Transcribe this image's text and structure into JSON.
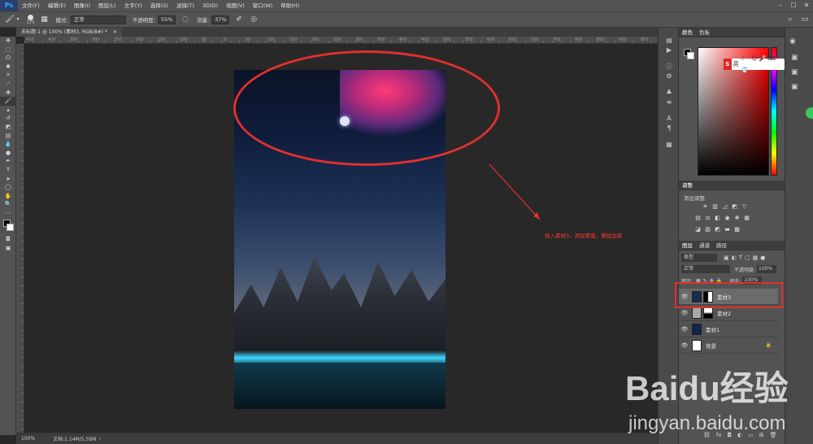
{
  "app": {
    "logo": "Ps"
  },
  "menu": [
    "文件(F)",
    "编辑(E)",
    "图像(I)",
    "图层(L)",
    "文字(Y)",
    "选择(S)",
    "滤镜(T)",
    "3D(D)",
    "视图(V)",
    "窗口(W)",
    "帮助(H)"
  ],
  "options": {
    "brush_size": "175",
    "mode_label": "模式:",
    "mode_value": "正常",
    "opacity_label": "不透明度:",
    "opacity_value": "55%",
    "flow_label": "流量:",
    "flow_value": "37%"
  },
  "document": {
    "tab_title": "未标题-1 @ 100% (素材3, RGB/8#) *",
    "zoom": "100%",
    "doc_size": "文档:1.14M/5.59M"
  },
  "ruler_ticks": [
    "450",
    "400",
    "350",
    "300",
    "250",
    "200",
    "150",
    "100",
    "50",
    "0",
    "50",
    "100",
    "150",
    "200",
    "250",
    "300",
    "350",
    "400",
    "450",
    "500",
    "550",
    "600",
    "650",
    "700",
    "750",
    "800",
    "850",
    "900",
    "950",
    "1000",
    "1050",
    "1100"
  ],
  "annotation": {
    "note": "插入素材3，添加蒙版，擦拭边缘"
  },
  "panels": {
    "color_tabs": [
      "颜色",
      "色板"
    ],
    "adjust_tab": "调整",
    "adjust_add": "添加调整",
    "layers_tabs": [
      "图层",
      "通道",
      "路径"
    ],
    "filter_kind": "类型",
    "blend_mode": "正常",
    "opacity_label": "不透明度:",
    "opacity_value": "100%",
    "lock_label": "锁定:",
    "fill_label": "填充:",
    "fill_value": "100%"
  },
  "layers": [
    {
      "name": "素材3",
      "selected": true,
      "thumb": "#1c2c4e"
    },
    {
      "name": "素材2",
      "selected": false,
      "thumb": "#a8a8a8"
    },
    {
      "name": "素材1",
      "selected": false,
      "thumb": "#14244a"
    },
    {
      "name": "背景",
      "selected": false,
      "thumb": "#ffffff"
    }
  ],
  "ime": {
    "label": "英"
  },
  "watermark": {
    "brand": "Baidu经验",
    "url": "jingyan.baidu.com"
  }
}
